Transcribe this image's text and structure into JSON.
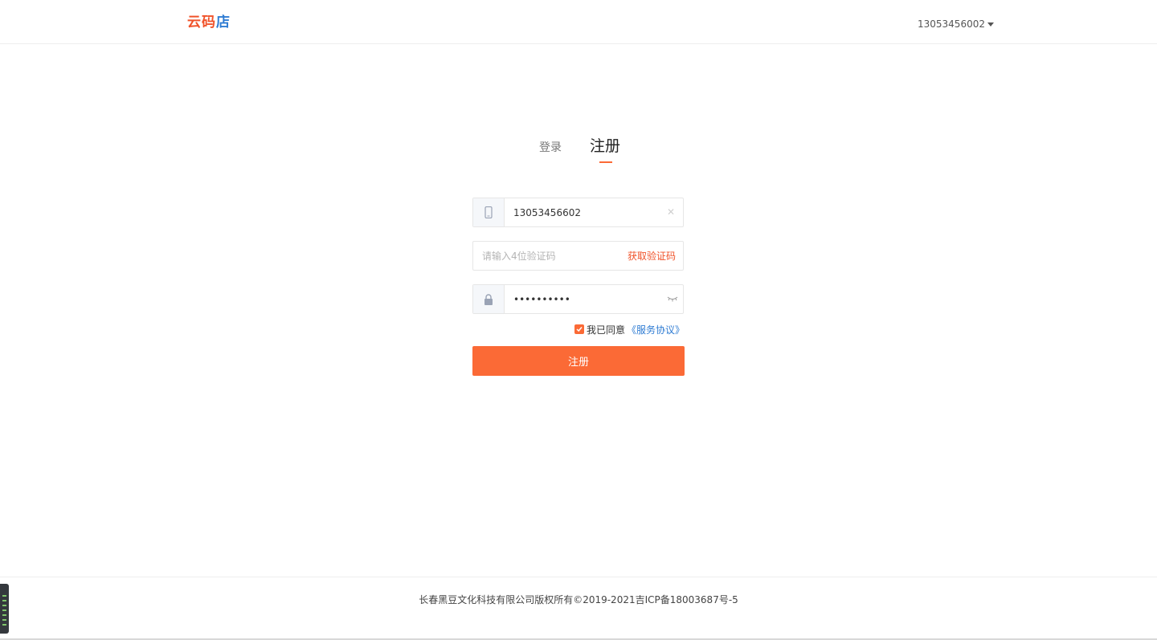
{
  "header": {
    "logo_main": "云码",
    "logo_accent": "店",
    "user_phone": "13053456002"
  },
  "tabs": {
    "login_label": "登录",
    "register_label": "注册",
    "active": "register"
  },
  "form": {
    "phone_value": "13053456602",
    "code_placeholder": "请输入4位验证码",
    "get_code_label": "获取验证码",
    "password_value": "••••••••••",
    "agree_text": "我已同意",
    "agree_link": "《服务协议》",
    "agree_checked": true,
    "submit_label": "注册"
  },
  "icons": {
    "phone": "phone-icon",
    "lock": "lock-icon",
    "clear": "clear-icon",
    "eye": "eye-closed-icon",
    "caret": "caret-down-icon",
    "check": "check-icon"
  },
  "colors": {
    "accent": "#fb6a36",
    "link": "#2f7cd3",
    "logo": "#f0532a"
  },
  "footer": {
    "copyright": "长春黑豆文化科技有限公司版权所有©2019-2021吉ICP备18003687号-5"
  }
}
